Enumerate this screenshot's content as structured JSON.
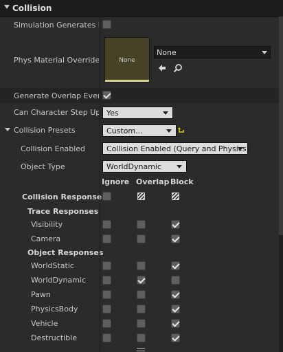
{
  "section": {
    "title": "Collision"
  },
  "properties": {
    "sim_hit": "Simulation Generates Hit Events",
    "phys_mat": "Phys Material Override",
    "phys_mat_thumb": "None",
    "phys_mat_value": "None",
    "gen_overlap": "Generate Overlap Events",
    "can_step": "Can Character Step Up On",
    "can_step_value": "Yes",
    "presets": "Collision Presets",
    "presets_value": "Custom...",
    "enabled": "Collision Enabled",
    "enabled_value": "Collision Enabled (Query and Physics)",
    "object_type": "Object Type",
    "object_type_value": "WorldDynamic"
  },
  "columns": {
    "ignore": "Ignore",
    "overlap": "Overlap",
    "block": "Block"
  },
  "responses": {
    "title": "Collision Responses",
    "trace_title": "Trace Responses",
    "object_title": "Object Responses"
  },
  "trace_channels": [
    {
      "label": "Visibility",
      "state": "block"
    },
    {
      "label": "Camera",
      "state": "block"
    }
  ],
  "object_channels": [
    {
      "label": "WorldStatic",
      "state": "block"
    },
    {
      "label": "WorldDynamic",
      "state": "overlap"
    },
    {
      "label": "Pawn",
      "state": "block"
    },
    {
      "label": "PhysicsBody",
      "state": "block"
    },
    {
      "label": "Vehicle",
      "state": "block"
    },
    {
      "label": "Destructible",
      "state": "block"
    }
  ],
  "states": {
    "sim_hit": false,
    "gen_overlap": true,
    "all_responses": "mixed"
  },
  "icons": {
    "browse": "browse-arrow-icon",
    "find": "magnifier-icon",
    "reset": "reset-to-default-icon",
    "expand": "expand-arrow-icon"
  },
  "colors": {
    "panel": "#2b2b2b",
    "header": "#1c1c1c",
    "checkbox": "#5f5f5f",
    "reset_icon": "#e3d21c",
    "thumb": "#454226"
  }
}
